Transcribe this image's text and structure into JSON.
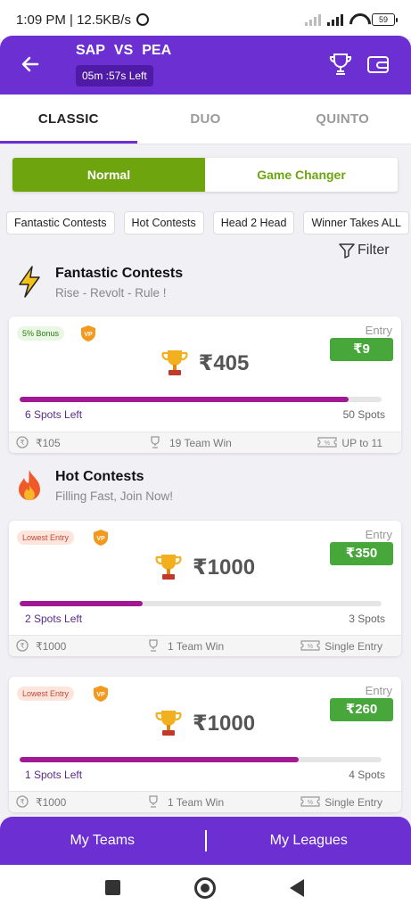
{
  "status": {
    "time": "1:09 PM | 12.5KB/s",
    "battery": "59"
  },
  "header": {
    "team1": "SAP",
    "vs": "VS",
    "team2": "PEA",
    "timer": "05m :57s Left"
  },
  "tabs": [
    "CLASSIC",
    "DUO",
    "QUINTO"
  ],
  "toggle": {
    "on": "Normal",
    "off": "Game Changer"
  },
  "chips": [
    "Fantastic Contests",
    "Hot Contests",
    "Head 2 Head",
    "Winner Takes ALL"
  ],
  "filter": "Filter",
  "sections": [
    {
      "title": "Fantastic Contests",
      "subtitle": "Rise - Revolt - Rule !"
    },
    {
      "title": "Hot Contests",
      "subtitle": "Filling Fast, Join Now!"
    }
  ],
  "entry_label": "Entry",
  "cards": [
    {
      "badge": "5% Bonus",
      "entry": "₹9",
      "prize": "₹405",
      "fill": 0.91,
      "spots_left": "6 Spots Left",
      "spots_total": "50 Spots",
      "foot_prize": "₹105",
      "foot_win": "19 Team Win",
      "foot_entry": "UP to 11"
    },
    {
      "badge": "Lowest Entry",
      "entry": "₹350",
      "prize": "₹1000",
      "fill": 0.34,
      "spots_left": "2 Spots Left",
      "spots_total": "3 Spots",
      "foot_prize": "₹1000",
      "foot_win": "1 Team Win",
      "foot_entry": "Single Entry"
    },
    {
      "badge": "Lowest Entry",
      "entry": "₹260",
      "prize": "₹1000",
      "fill": 0.77,
      "spots_left": "1 Spots Left",
      "spots_total": "4 Spots",
      "foot_prize": "₹1000",
      "foot_win": "1 Team Win",
      "foot_entry": "Single Entry"
    }
  ],
  "bottom": {
    "my_teams": "My Teams",
    "my_leagues": "My Leagues"
  },
  "colors": {
    "brand": "#6c2fd2",
    "green": "#6ea50f",
    "entry_green": "#47a73b",
    "progress": "#a21a93"
  }
}
